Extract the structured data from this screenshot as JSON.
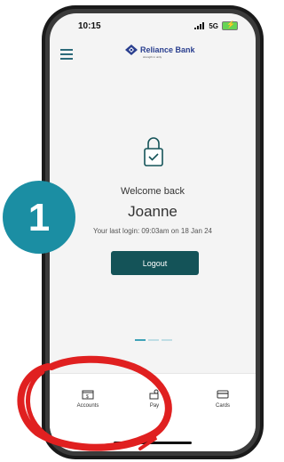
{
  "status": {
    "time": "10:15",
    "network": "5G"
  },
  "header": {
    "brand": "Reliance Bank",
    "tagline": "strength in unity"
  },
  "main": {
    "welcome": "Welcome back",
    "username": "Joanne",
    "last_login": "Your last login: 09:03am on 18 Jan 24",
    "logout_label": "Logout"
  },
  "tabs": [
    {
      "label": "Accounts",
      "icon": "accounts-icon"
    },
    {
      "label": "Pay",
      "icon": "pay-icon"
    },
    {
      "label": "Cards",
      "icon": "cards-icon"
    }
  ],
  "overlay": {
    "step_number": "1"
  },
  "colors": {
    "accent": "#145358",
    "badge": "#1b8ea3",
    "annotation_red": "#e02020"
  }
}
